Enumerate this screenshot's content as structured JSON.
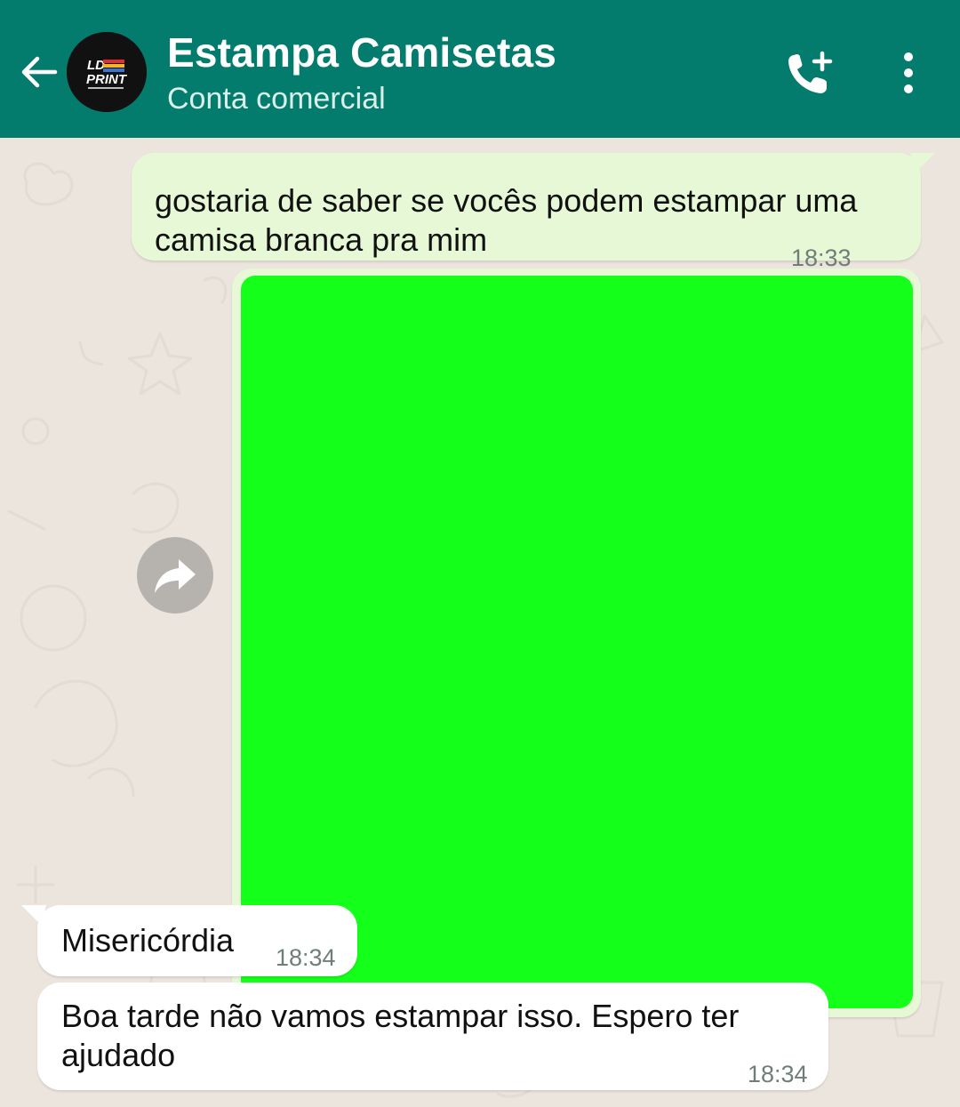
{
  "header": {
    "title": "Estampa Camisetas",
    "subtitle": "Conta comercial",
    "avatar_logo_text": "LD PRINT",
    "icons": {
      "back": "arrow-left-icon",
      "call": "add-call-icon",
      "menu": "more-vertical-icon"
    }
  },
  "colors": {
    "header": "#047c6d",
    "chat_background": "#ece5dd",
    "outgoing_bubble": "#e6f8d6",
    "incoming_bubble": "#ffffff",
    "read_ticks": "#34a3d8",
    "image_placeholder": "#14ff1a"
  },
  "messages": [
    {
      "direction": "outgoing",
      "text": "gostaria de saber se vocês podem estampar uma camisa branca pra mim",
      "time": "18:33",
      "status": "read"
    },
    {
      "direction": "outgoing",
      "type": "image",
      "forward_icon": "forward-icon"
    },
    {
      "direction": "incoming",
      "text": "Misericórdia",
      "time": "18:34"
    },
    {
      "direction": "incoming",
      "text": "Boa tarde não vamos estampar isso. Espero ter ajudado",
      "time": "18:34"
    }
  ]
}
